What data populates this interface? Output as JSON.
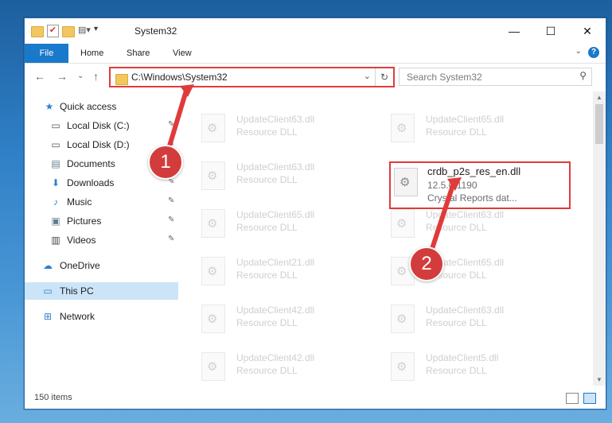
{
  "window": {
    "title": "System32"
  },
  "ribbon": {
    "file": "File",
    "home": "Home",
    "share": "Share",
    "view": "View",
    "help": "?"
  },
  "address": {
    "path": "C:\\Windows\\System32"
  },
  "search": {
    "placeholder": "Search System32"
  },
  "sidebar": {
    "items": [
      {
        "label": "Quick access",
        "icon": "star-icon"
      },
      {
        "label": "Local Disk (C:)",
        "icon": "drive-icon"
      },
      {
        "label": "Local Disk (D:)",
        "icon": "drive-icon"
      },
      {
        "label": "Documents",
        "icon": "documents-icon"
      },
      {
        "label": "Downloads",
        "icon": "download-icon"
      },
      {
        "label": "Music",
        "icon": "music-icon"
      },
      {
        "label": "Pictures",
        "icon": "pictures-icon"
      },
      {
        "label": "Videos",
        "icon": "videos-icon"
      },
      {
        "label": "OneDrive",
        "icon": "cloud-icon"
      },
      {
        "label": "This PC",
        "icon": "computer-icon"
      },
      {
        "label": "Network",
        "icon": "network-icon"
      }
    ]
  },
  "files": [
    {
      "name": "UpdateClient63.dll",
      "desc": "Resource DLL"
    },
    {
      "name": "UpdateClient65.dll",
      "desc": "Resource DLL"
    },
    {
      "name": "UpdateClient63.dll",
      "desc": "Resource DLL"
    },
    {
      "name": "crdb_p2s_res_en.dll",
      "desc": "12.5.0.1190",
      "desc2": "Crystal Reports dat..."
    },
    {
      "name": "UpdateClient65.dll",
      "desc": "Resource DLL"
    },
    {
      "name": "UpdateClient63.dll",
      "desc": "Resource DLL"
    },
    {
      "name": "UpdateClient21.dll",
      "desc": "Resource DLL"
    },
    {
      "name": "UpdateClient65.dll",
      "desc": "Resource DLL"
    },
    {
      "name": "UpdateClient42.dll",
      "desc": "Resource DLL"
    },
    {
      "name": "UpdateClient63.dll",
      "desc": "Resource DLL"
    },
    {
      "name": "UpdateClient42.dll",
      "desc": "Resource DLL"
    },
    {
      "name": "UpdateClient5.dll",
      "desc": "Resource DLL"
    }
  ],
  "status": {
    "count": "150 items"
  },
  "annotations": {
    "step1": "1",
    "step2": "2"
  },
  "colors": {
    "accent": "#1979ca",
    "highlight": "#e03b3b",
    "selected": "#cce4f7"
  }
}
